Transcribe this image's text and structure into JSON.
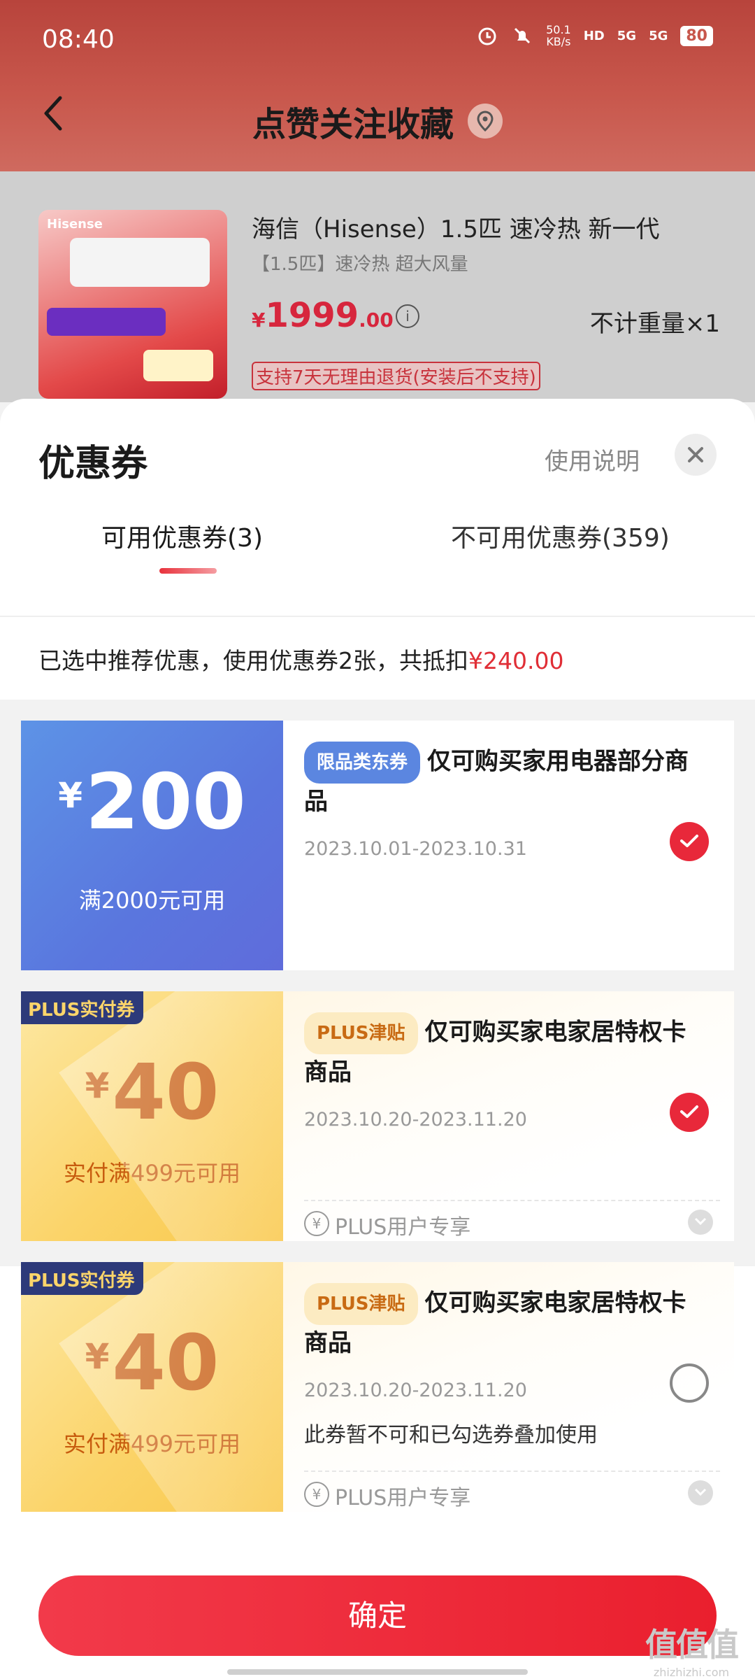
{
  "status_bar": {
    "time": "08:40",
    "net_speed": "50.1\nKB/s",
    "hd": "HD",
    "sig1": "5G",
    "sig2": "5G",
    "battery": "80"
  },
  "nav": {
    "title": "点赞关注收藏"
  },
  "product": {
    "name": "海信（Hisense）1.5匹 速冷热 新一代",
    "sub": "【1.5匹】速冷热 超大风量",
    "price_currency": "¥",
    "price_int": "1999",
    "price_dec": ".00",
    "weight": "不计重量×1",
    "return_policy": "支持7天无理由退货(安装后不支持)",
    "image_brand": "Hisense"
  },
  "sheet": {
    "title": "优惠券",
    "usage_link": "使用说明",
    "close_icon": "close-icon"
  },
  "tabs": {
    "available": "可用优惠券(3)",
    "unavailable": "不可用优惠券(359)"
  },
  "summary": {
    "text": "已选中推荐优惠，使用优惠券2张，共抵扣",
    "amount": "¥240.00"
  },
  "coupons": [
    {
      "yen": "¥",
      "amount": "200",
      "condition": "满2000元可用",
      "badge": "限品类东券",
      "title": "仅可购买家用电器部分商品",
      "date": "2023.10.01-2023.10.31",
      "checked": true
    },
    {
      "label": "PLUS实付券",
      "yen": "¥",
      "amount": "40",
      "condition": "实付满499元可用",
      "badge": "PLUS津贴",
      "title": "仅可购买家电家居特权卡商品",
      "date": "2023.10.20-2023.11.20",
      "footer": "PLUS用户专享",
      "checked": true
    },
    {
      "label": "PLUS实付券",
      "yen": "¥",
      "amount": "40",
      "condition": "实付满499元可用",
      "badge": "PLUS津贴",
      "title": "仅可购买家电家居特权卡商品",
      "date": "2023.10.20-2023.11.20",
      "note": "此券暂不可和已勾选券叠加使用",
      "footer": "PLUS用户专享",
      "checked": false
    }
  ],
  "confirm_label": "确定",
  "watermark": {
    "line1": "值值值",
    "line2": "zhizhizhi.com"
  },
  "colors": {
    "accent": "#e8283a",
    "blue_coupon": "#5a7fe0",
    "gold_coupon": "#fbd46a"
  }
}
